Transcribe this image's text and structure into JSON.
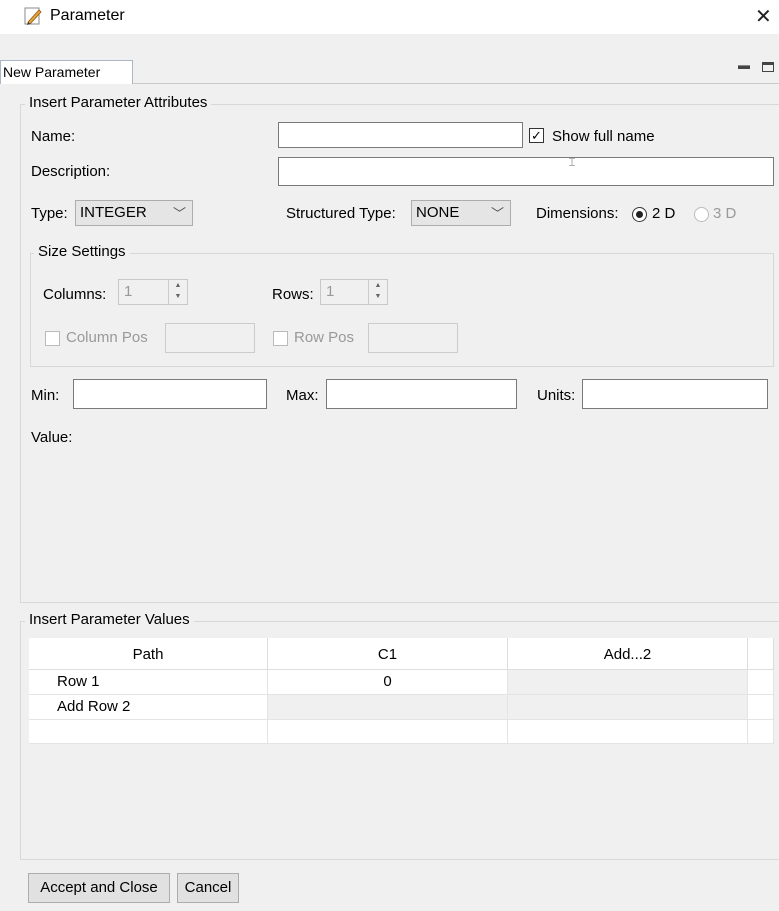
{
  "window": {
    "title": "Parameter",
    "close": "✕"
  },
  "tab": {
    "label": "New Parameter"
  },
  "attributes": {
    "legend": "Insert Parameter Attributes",
    "name_label": "Name:",
    "show_full_name": "Show full name",
    "show_full_name_checked": true,
    "description_label": "Description:",
    "type_label": "Type:",
    "type_value": "INTEGER",
    "structured_type_label": "Structured Type:",
    "structured_type_value": "NONE",
    "dimensions_label": "Dimensions:",
    "dim_2d": "2 D",
    "dim_3d": "3 D",
    "size": {
      "legend": "Size Settings",
      "columns_label": "Columns:",
      "columns_value": "1",
      "rows_label": "Rows:",
      "rows_value": "1",
      "column_pos": "Column Pos",
      "row_pos": "Row Pos"
    },
    "min_label": "Min:",
    "max_label": "Max:",
    "units_label": "Units:",
    "value_label": "Value:"
  },
  "values": {
    "legend": "Insert Parameter Values",
    "headers": [
      "Path",
      "C1",
      "Add...2"
    ],
    "rows": [
      [
        "Row 1",
        "0",
        ""
      ],
      [
        "Add Row 2",
        "",
        ""
      ],
      [
        "",
        "",
        ""
      ]
    ]
  },
  "buttons": {
    "accept": "Accept and Close",
    "cancel": "Cancel"
  },
  "colors": {
    "accent": "#aab7c8",
    "background": "#f0f0f0"
  }
}
